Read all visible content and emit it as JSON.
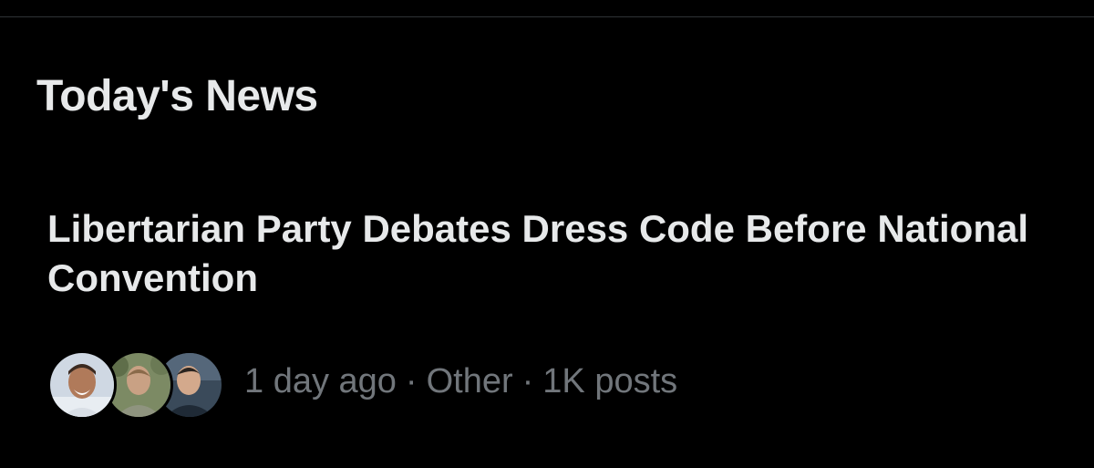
{
  "section": {
    "title": "Today's News"
  },
  "news_item": {
    "headline": "Libertarian Party Debates Dress Code Before National Convention",
    "time": "1 day ago",
    "category": "Other",
    "posts": "1K posts",
    "separator": "·",
    "avatars": [
      {
        "icon": "avatar-user-1"
      },
      {
        "icon": "avatar-user-2"
      },
      {
        "icon": "avatar-user-3"
      }
    ]
  },
  "colors": {
    "background": "#000000",
    "primary_text": "#e7e9ea",
    "secondary_text": "#71767b",
    "divider": "#2f3336"
  }
}
